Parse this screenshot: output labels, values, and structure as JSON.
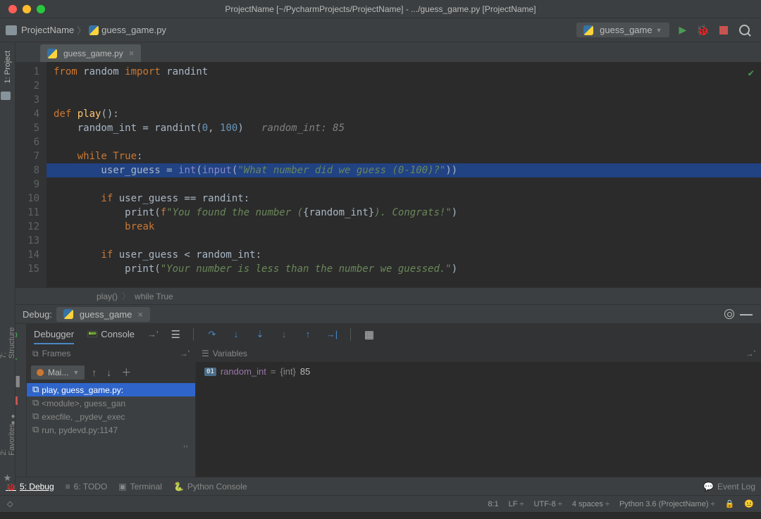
{
  "window": {
    "title": "ProjectName [~/PycharmProjects/ProjectName] - .../guess_game.py [ProjectName]"
  },
  "nav": {
    "project": "ProjectName",
    "file": "guess_game.py",
    "config": "guess_game"
  },
  "left_tools": {
    "project": "1: Project",
    "structure": "7: Structure",
    "favorites": "2: Favorites"
  },
  "editor": {
    "tab": "guess_game.py",
    "breakpoint_line": 8,
    "crumbs": {
      "fn": "play()",
      "loop": "while True"
    },
    "lines": {
      "l1_from": "from",
      "l1_mod": "random",
      "l1_imp": "import",
      "l1_name": "randint",
      "l4_def": "def",
      "l4_name": "play",
      "l4_rest": "():",
      "l5": "    random_int = randint(",
      "l5_n1": "0",
      "l5_c": ", ",
      "l5_n2": "100",
      "l5_e": ")",
      "l5_cmt": "   random_int: 85",
      "l7_w": "    while ",
      "l7_t": "True",
      "l7_c": ":",
      "l8": "        user_guess = ",
      "l8_int": "int",
      "l8_p1": "(",
      "l8_inp": "input",
      "l8_p2": "(",
      "l8_str": "\"What number did we guess (0-100)?\"",
      "l8_e": "))",
      "l10": "        if ",
      "l10_b": "user_guess == randint:",
      "l11": "            print(",
      "l11_f": "f",
      "l11_s": "\"You found the number (",
      "l11_b": "{random_int}",
      "l11_s2": "). Congrats!\"",
      "l11_e": ")",
      "l12": "            ",
      "l12_b": "break",
      "l14": "        if ",
      "l14_b": "user_guess < random_int:",
      "l15": "            print(",
      "l15_s": "\"Your number is less than the number we guessed.\"",
      "l15_e": ")"
    }
  },
  "debug": {
    "label": "Debug:",
    "tab": "guess_game",
    "tabs": {
      "debugger": "Debugger",
      "console": "Console"
    },
    "frames_label": "Frames",
    "vars_label": "Variables",
    "thread": "Mai...",
    "frames": {
      "f1": "play, guess_game.py:",
      "f2": "<module>, guess_gan",
      "f3": "execfile, _pydev_exec",
      "f4": "run, pydevd.py:1147"
    },
    "var": {
      "name": "random_int",
      "type": "{int}",
      "value": "85"
    }
  },
  "bottom": {
    "debug": "5: Debug",
    "todo": "6: TODO",
    "terminal": "Terminal",
    "pyconsole": "Python Console",
    "eventlog": "Event Log"
  },
  "status": {
    "pos": "8:1",
    "lf": "LF",
    "enc": "UTF-8",
    "indent": "4 spaces",
    "sdk": "Python 3.6 (ProjectName)"
  }
}
